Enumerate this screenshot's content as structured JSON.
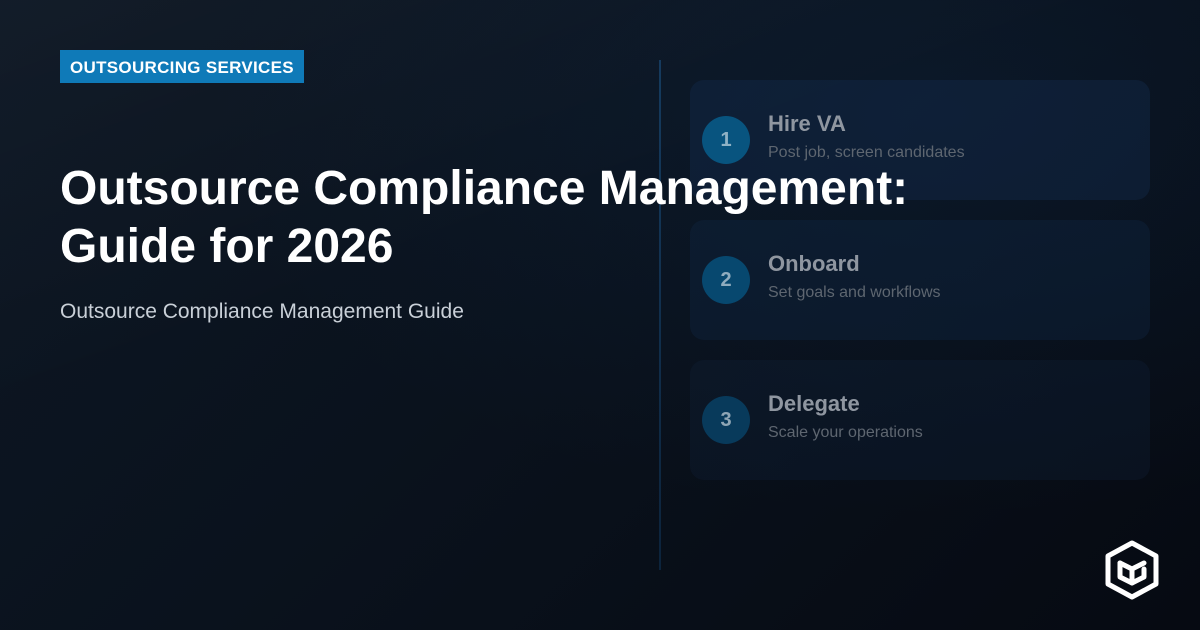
{
  "colors": {
    "accent": "#0f7ab8",
    "background": "#0a121d",
    "title_text": "#ffffff"
  },
  "badge": {
    "label": "OUTSOURCING SERVICES"
  },
  "headline": {
    "line1": "Outsource Compliance Management:",
    "line2": "Guide for 2026"
  },
  "subtitle": "Outsource Compliance Management Guide",
  "steps": [
    {
      "number": "1",
      "title": "Hire VA",
      "description": "Post job, screen candidates"
    },
    {
      "number": "2",
      "title": "Onboard",
      "description": "Set goals and workflows"
    },
    {
      "number": "3",
      "title": "Delegate",
      "description": "Scale your operations"
    }
  ],
  "logo": {
    "icon": "hexagon-cube-logo-icon"
  }
}
